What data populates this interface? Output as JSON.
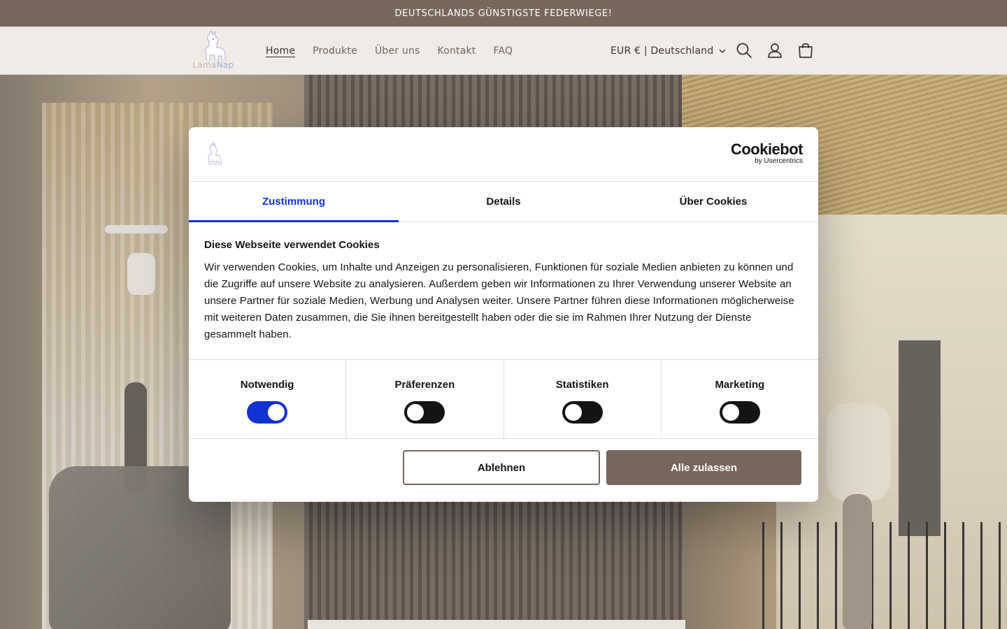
{
  "announcement": {
    "text": "DEUTSCHLANDS GÜNSTIGSTE FEDERWIEGE!"
  },
  "header": {
    "logo": {
      "part1": "Lama",
      "part2": "Nap"
    },
    "nav": [
      {
        "label": "Home",
        "active": true
      },
      {
        "label": "Produkte",
        "active": false
      },
      {
        "label": "Über uns",
        "active": false
      },
      {
        "label": "Kontakt",
        "active": false
      },
      {
        "label": "FAQ",
        "active": false
      }
    ],
    "country_selector": "EUR € | Deutschland",
    "icons": [
      "search-icon",
      "account-icon",
      "cart-icon"
    ]
  },
  "cookie_dialog": {
    "brand": {
      "name": "Cookiebot",
      "by": "by Usercentrics"
    },
    "tabs": [
      {
        "label": "Zustimmung",
        "active": true
      },
      {
        "label": "Details",
        "active": false
      },
      {
        "label": "Über Cookies",
        "active": false
      }
    ],
    "title": "Diese Webseite verwendet Cookies",
    "text": "Wir verwenden Cookies, um Inhalte und Anzeigen zu personalisieren, Funktionen für soziale Medien anbieten zu können und die Zugriffe auf unsere Website zu analysieren. Außerdem geben wir Informationen zu Ihrer Verwendung unserer Website an unsere Partner für soziale Medien, Werbung und Analysen weiter. Unsere Partner führen diese Informationen möglicherweise mit weiteren Daten zusammen, die Sie ihnen bereitgestellt haben oder die sie im Rahmen Ihrer Nutzung der Dienste gesammelt haben.",
    "toggles": [
      {
        "label": "Notwendig",
        "on": true
      },
      {
        "label": "Präferenzen",
        "on": false
      },
      {
        "label": "Statistiken",
        "on": false
      },
      {
        "label": "Marketing",
        "on": false
      }
    ],
    "buttons": {
      "reject": "Ablehnen",
      "accept": "Alle zulassen"
    }
  },
  "colors": {
    "brand": "#78675d",
    "accent": "#1032cf",
    "header_bg": "#f0ebe7"
  }
}
